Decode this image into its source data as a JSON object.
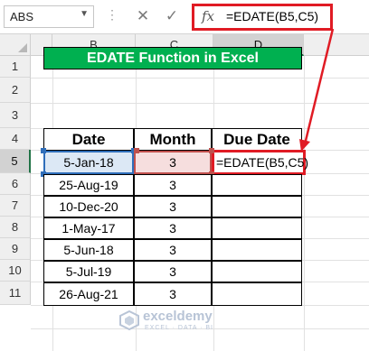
{
  "name_box": {
    "value": "ABS"
  },
  "formula_bar": {
    "cancel_symbol": "✕",
    "enter_symbol": "✓",
    "fx_label": "fx",
    "formula": "=EDATE(B5,C5)"
  },
  "columns": [
    "B",
    "C",
    "D"
  ],
  "rows": [
    "1",
    "2",
    "3",
    "4",
    "5",
    "6",
    "7",
    "8",
    "9",
    "10",
    "11"
  ],
  "title": "EDATE Function in Excel",
  "table": {
    "headers": [
      "Date",
      "Month",
      "Due Date"
    ],
    "rows": [
      {
        "date": "5-Jan-18",
        "month": "3",
        "due": "=EDATE(B5,C5)"
      },
      {
        "date": "25-Aug-19",
        "month": "3",
        "due": ""
      },
      {
        "date": "10-Dec-20",
        "month": "3",
        "due": ""
      },
      {
        "date": "1-May-17",
        "month": "3",
        "due": ""
      },
      {
        "date": "5-Jun-18",
        "month": "3",
        "due": ""
      },
      {
        "date": "5-Jul-19",
        "month": "3",
        "due": ""
      },
      {
        "date": "26-Aug-21",
        "month": "3",
        "due": ""
      }
    ]
  },
  "watermark": {
    "name": "exceldemy",
    "tagline": "EXCEL · DATA · BI"
  },
  "colors": {
    "title_fill": "#00b050",
    "highlight_red": "#e01b24",
    "ref_blue": "#2f6eba",
    "ref_red": "#c0504d"
  }
}
